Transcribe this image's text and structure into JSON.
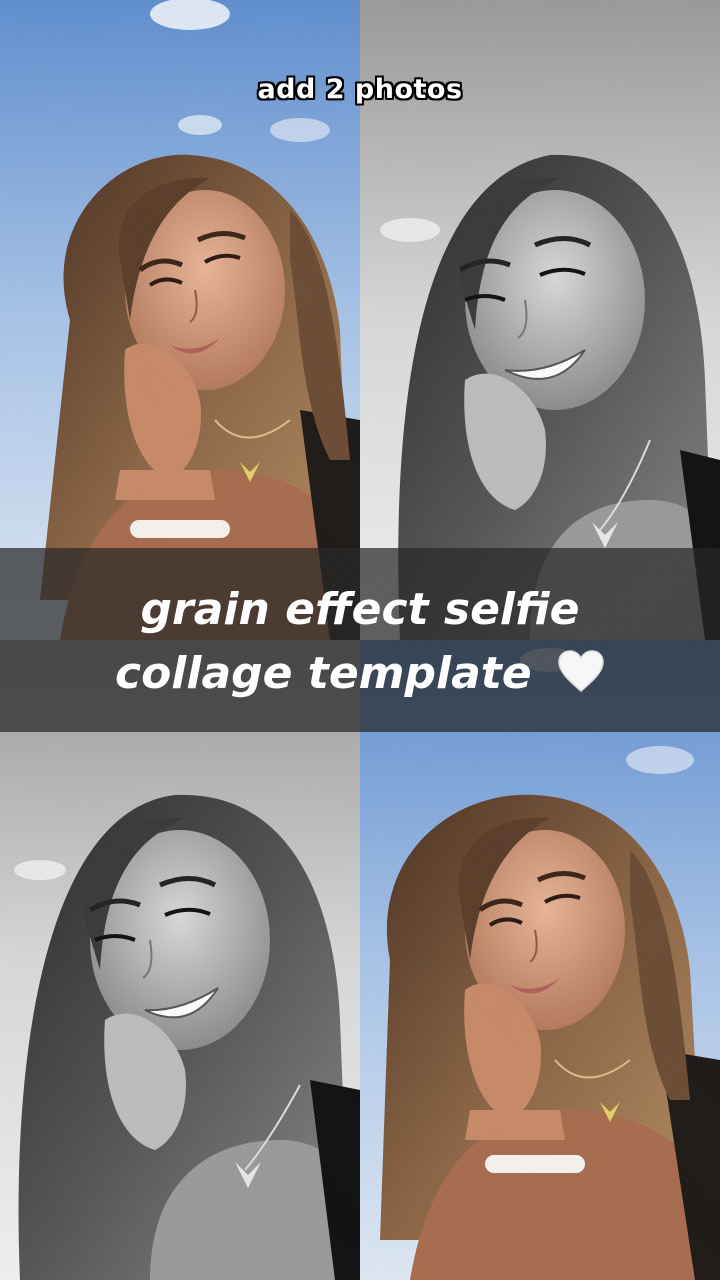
{
  "overlay": {
    "top_label": "add 2 photos",
    "headline_line1": "grain effect selfie",
    "headline_line2": "collage template",
    "heart_icon": "white-heart-icon"
  },
  "photos": [
    {
      "name": "top-left",
      "tone": "color"
    },
    {
      "name": "top-right",
      "tone": "black-and-white"
    },
    {
      "name": "bottom-left",
      "tone": "black-and-white"
    },
    {
      "name": "bottom-right",
      "tone": "color"
    }
  ],
  "colors": {
    "sky_color": "#8fb3e0",
    "band_color": "#282828",
    "text_color": "#ffffff"
  }
}
